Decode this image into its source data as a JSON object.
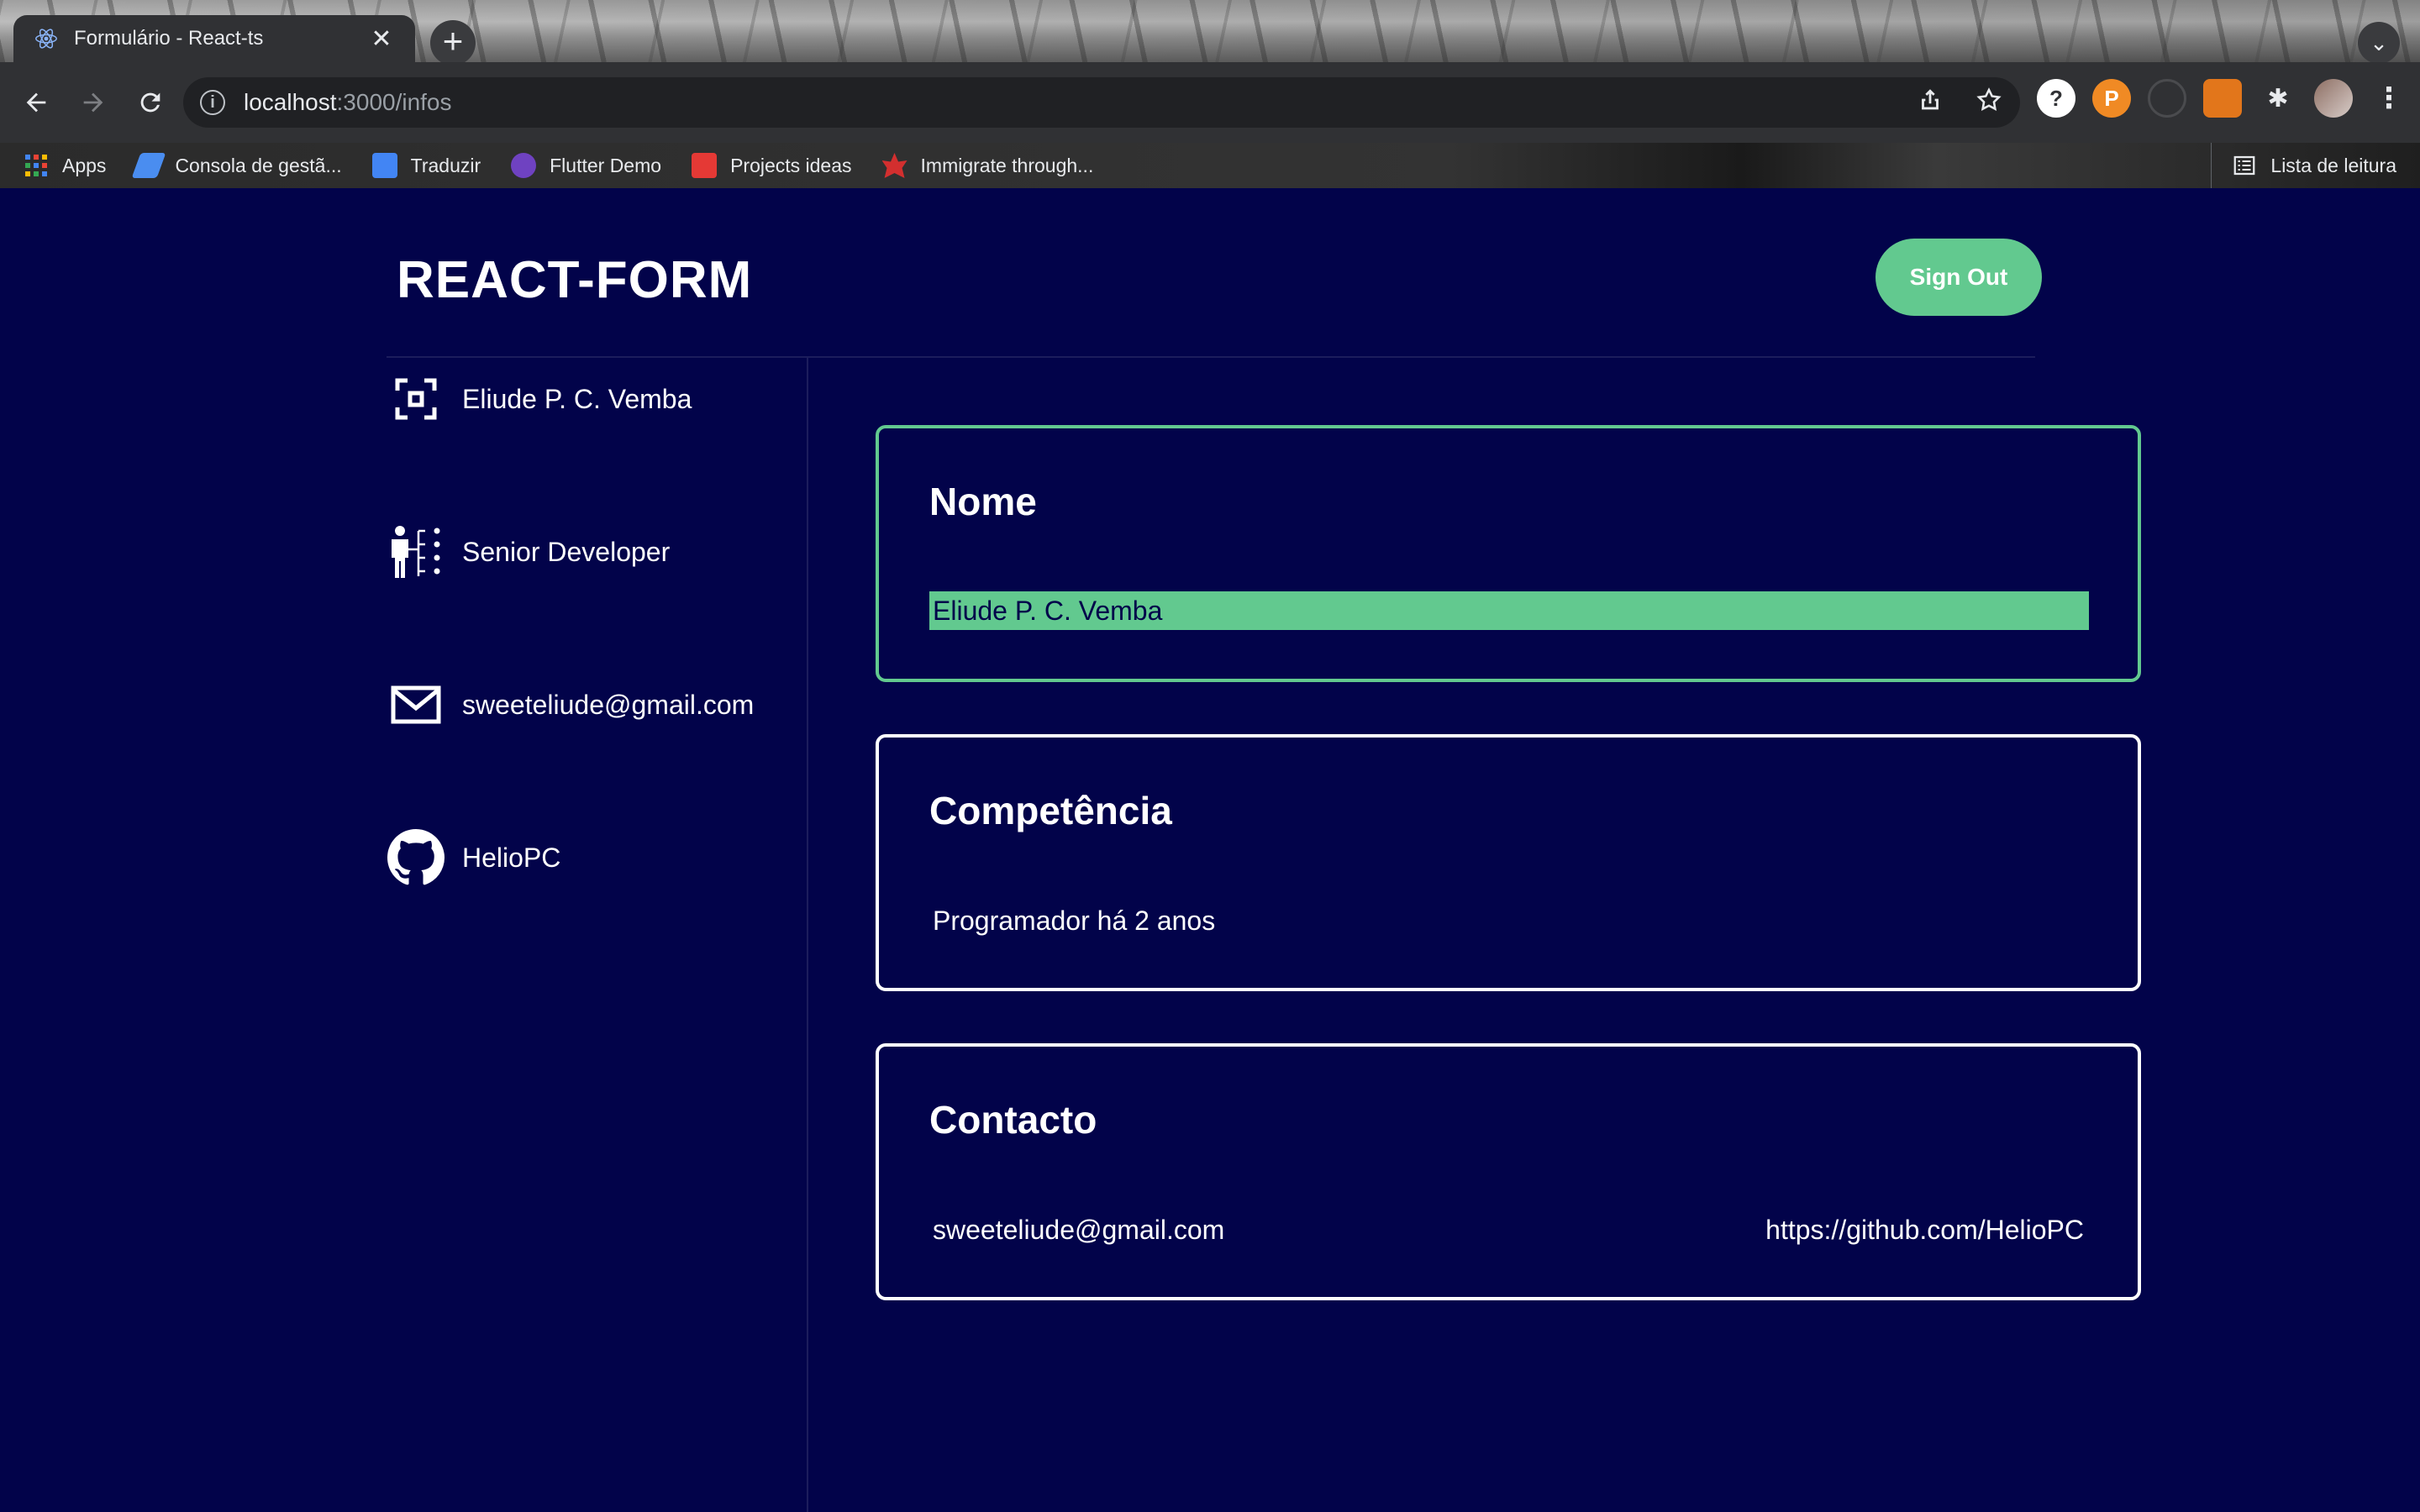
{
  "browser": {
    "tab_title": "Formulário - React-ts",
    "tab_close": "✕",
    "new_tab": "+",
    "tab_search": "⌄",
    "url_host": "localhost",
    "url_path": ":3000/infos",
    "bookmarks": [
      {
        "label": "Apps",
        "color": "#4285f4"
      },
      {
        "label": "Consola de gestã...",
        "color": "#4a8df0"
      },
      {
        "label": "Traduzir",
        "color": "#4285f4"
      },
      {
        "label": "Flutter Demo",
        "color": "#6f42c1"
      },
      {
        "label": "Projects ideas",
        "color": "#e53935"
      },
      {
        "label": "Immigrate through...",
        "color": "#d32f2f"
      }
    ],
    "reading_list": "Lista de leitura"
  },
  "app": {
    "brand": "REACT-FORM",
    "signout_label": "Sign Out",
    "accent_color": "#62c98f",
    "background_color": "#02034a"
  },
  "sidebar": {
    "items": [
      {
        "label": "Eliude P. C. Vemba",
        "icon": "face-scan-icon"
      },
      {
        "label": "Senior Developer",
        "icon": "org-chart-person-icon"
      },
      {
        "label": "sweeteliude@gmail.com",
        "icon": "mail-icon"
      },
      {
        "label": "HelioPC",
        "icon": "github-icon"
      }
    ]
  },
  "cards": {
    "nome": {
      "title": "Nome",
      "value": "Eliude P. C. Vemba"
    },
    "competencia": {
      "title": "Competência",
      "value": "Programador há 2 anos"
    },
    "contacto": {
      "title": "Contacto",
      "email": "sweeteliude@gmail.com",
      "github": "https://github.com/HelioPC"
    }
  }
}
